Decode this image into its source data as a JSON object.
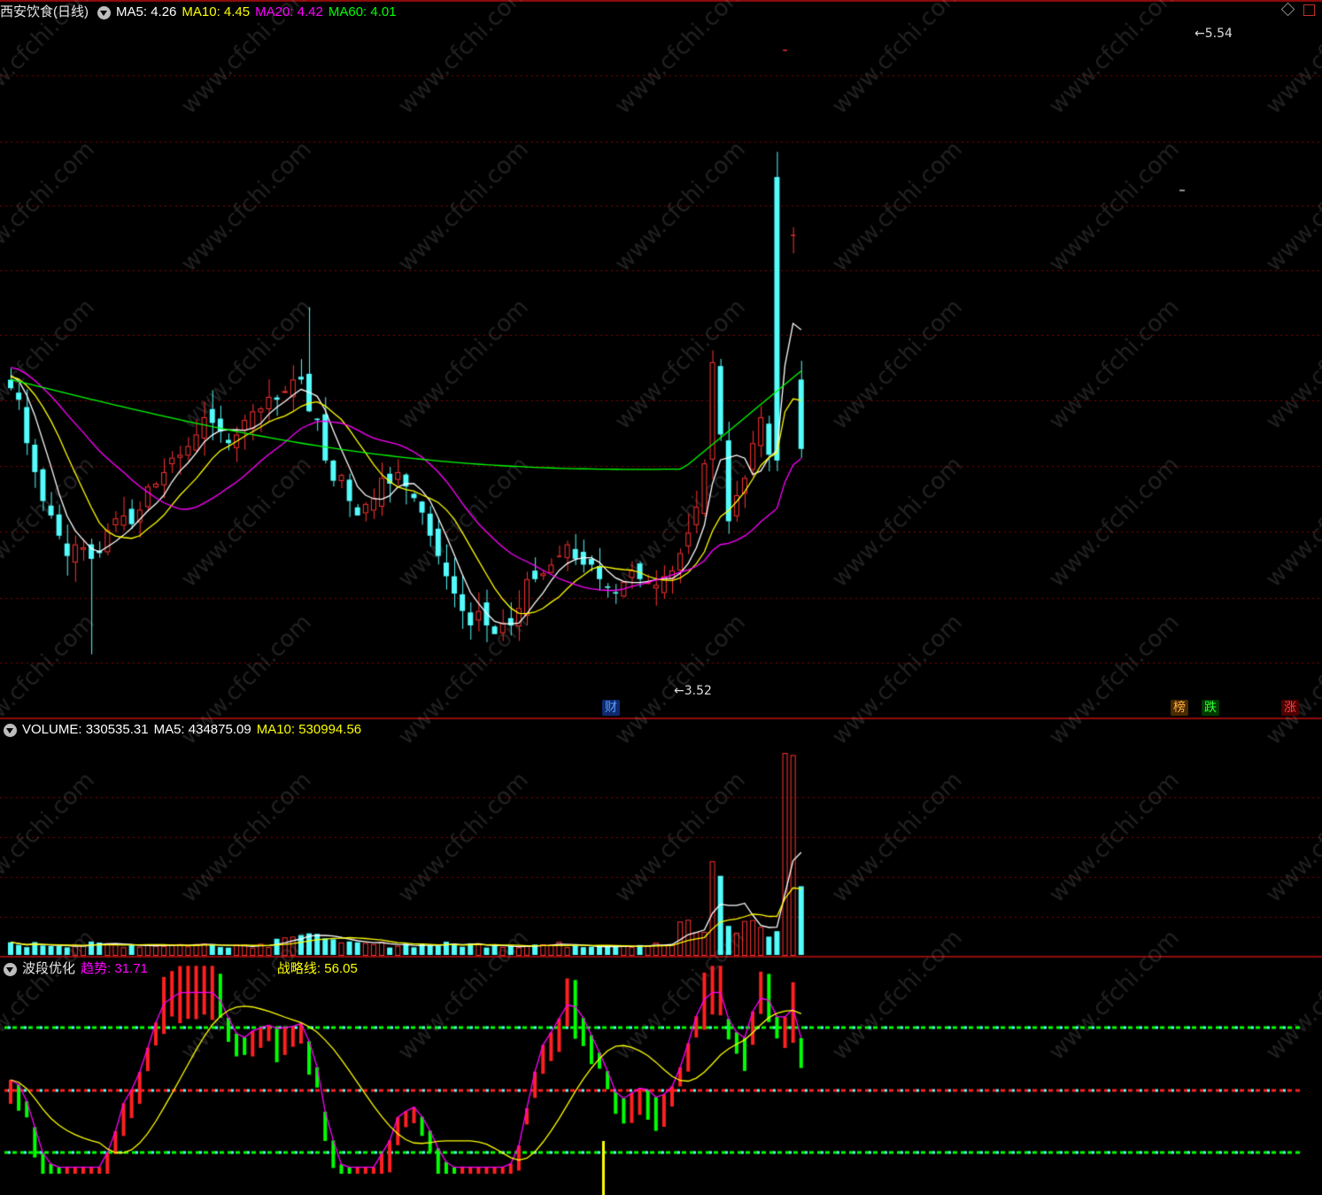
{
  "price_panel": {
    "stock_name": "西安饮食(日线)",
    "ma5": {
      "label": "MA5:",
      "value": "4.26",
      "color": "#ffffff"
    },
    "ma10": {
      "label": "MA10:",
      "value": "4.45",
      "color": "#ffff00"
    },
    "ma20": {
      "label": "MA20:",
      "value": "4.42",
      "color": "#ff00ff"
    },
    "ma60": {
      "label": "MA60:",
      "value": "4.01",
      "color": "#00ff00"
    },
    "high_label": "5.54",
    "low_label": "3.52",
    "markers": [
      {
        "text": "财",
        "color": "#5aa0ff",
        "bg": "#0f2a6e"
      },
      {
        "text": "榜",
        "color": "#ffb040",
        "bg": "#4a2a00"
      },
      {
        "text": "跌",
        "color": "#30ff30",
        "bg": "#003a00"
      },
      {
        "text": "涨",
        "color": "#ff4040",
        "bg": "#4a0000"
      }
    ]
  },
  "volume_panel": {
    "volume": {
      "label": "VOLUME:",
      "value": "330535.31",
      "color": "#ffffff"
    },
    "ma5": {
      "label": "MA5:",
      "value": "434875.09",
      "color": "#ffffff"
    },
    "ma10": {
      "label": "MA10:",
      "value": "530994.56",
      "color": "#ffff00"
    }
  },
  "indicator_panel": {
    "name": "波段优化",
    "trend": {
      "label": "趋势:",
      "value": "31.71",
      "color": "#ff00ff"
    },
    "strategy": {
      "label": "战略线:",
      "value": "56.05",
      "color": "#ffff00"
    }
  },
  "watermark": "www.cfchi.com",
  "colors": {
    "up": "#ff3232",
    "down": "#54fcfc",
    "grid": "#8b0000",
    "ma5": "#ffffff",
    "ma10": "#ffff00",
    "ma20": "#ff00ff",
    "ma60": "#00ff00",
    "ind_green": "#00ff00",
    "ind_red": "#ff2020",
    "ind_cyan": "#54fcfc"
  },
  "chart_data": {
    "type": "candlestick",
    "days": 99,
    "price_range": [
      3.4,
      5.62
    ],
    "close": [
      4.37,
      4.33,
      4.18,
      4.08,
      3.98,
      3.93,
      3.86,
      3.79,
      3.83,
      3.82,
      3.78,
      3.8,
      3.88,
      3.92,
      3.93,
      3.9,
      3.95,
      4.03,
      4.04,
      4.08,
      4.13,
      4.14,
      4.17,
      4.21,
      4.27,
      4.25,
      4.22,
      4.18,
      4.21,
      4.26,
      4.29,
      4.3,
      4.34,
      4.33,
      4.36,
      4.4,
      4.4,
      4.29,
      4.26,
      4.12,
      4.05,
      4.07,
      3.98,
      3.93,
      3.97,
      3.99,
      4.06,
      4.04,
      4.08,
      4.03,
      3.99,
      3.94,
      3.86,
      3.79,
      3.72,
      3.66,
      3.6,
      3.55,
      3.6,
      3.55,
      3.52,
      3.56,
      3.55,
      3.61,
      3.71,
      3.71,
      3.73,
      3.76,
      3.79,
      3.83,
      3.78,
      3.76,
      3.76,
      3.71,
      3.68,
      3.66,
      3.7,
      3.74,
      3.71,
      3.7,
      3.69,
      3.72,
      3.74,
      3.8,
      3.87,
      3.96,
      4.11,
      4.46,
      4.21,
      3.91,
      4.0,
      4.06,
      4.18,
      4.27,
      4.14,
      4.12,
      5.54,
      4.9,
      4.16
    ],
    "volume_ma5": 434875.09,
    "volume_ma10": 530994.56,
    "volume_last": 330535.31,
    "indicator_trend_last": 31.71,
    "indicator_strategy_last": 56.05
  }
}
